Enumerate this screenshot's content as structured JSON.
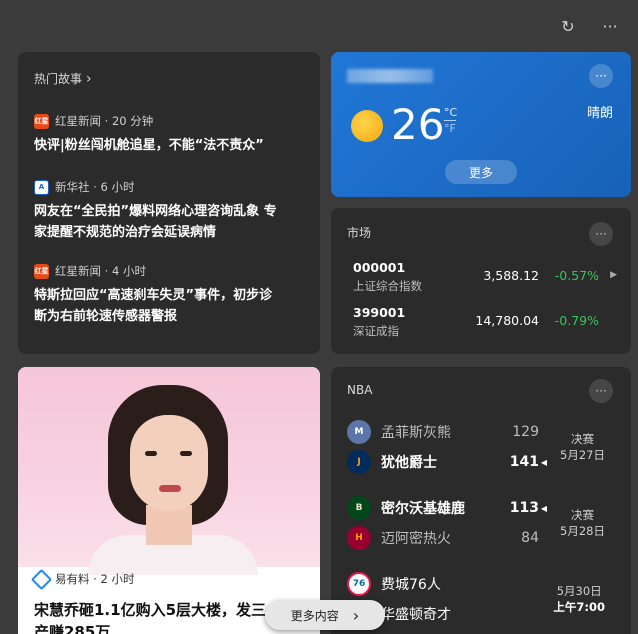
{
  "topbar": {
    "refresh_icon": "↻",
    "more_icon": "···"
  },
  "news": {
    "title": "热门故事",
    "chevron": "›",
    "items": [
      {
        "icon_label": "红星",
        "source": "红星新闻 · 20 分钟",
        "headline": "快评|粉丝闯机舱追星，不能“法不责众”"
      },
      {
        "icon_label": "A",
        "source": "新华社 · 6 小时",
        "headline_line1": "网友在“全民拍”爆料网络心理咨询乱象 专",
        "headline_line2": "家提醒不规范的治疗会延误病情"
      },
      {
        "icon_label": "红星",
        "source": "红星新闻 · 4 小时",
        "headline_line1": "特斯拉回应“高速刹车失灵”事件，初步诊",
        "headline_line2": "断为右前轮速传感器警报"
      }
    ]
  },
  "weather": {
    "more_icon": "···",
    "temperature": "26",
    "unit_c": "°C",
    "unit_f": "°F",
    "condition": "晴朗",
    "more_label": "更多",
    "accent": "#1f6fc9"
  },
  "market": {
    "title": "市场",
    "more_icon": "···",
    "rows": [
      {
        "code": "000001",
        "name": "上证综合指数",
        "price": "3,588.12",
        "change": "-0.57%",
        "arrow": "▶"
      },
      {
        "code": "399001",
        "name": "深证成指",
        "price": "14,780.04",
        "change": "-0.79%"
      }
    ],
    "change_color": "#39c45a"
  },
  "photo_news": {
    "source": "易有料 · 2 小时",
    "headline": "宋慧乔砸1.1亿购入5层大楼，发三",
    "headline_line2": "产赚285万"
  },
  "nba": {
    "title": "NBA",
    "more_icon": "···",
    "games": [
      {
        "team1": {
          "name": "孟菲斯灰熊",
          "score": "129"
        },
        "team2": {
          "name": "犹他爵士",
          "score": "141"
        },
        "status1": "决赛",
        "status2": "5月27日"
      },
      {
        "team1": {
          "name": "密尔沃基雄鹿",
          "score": "113"
        },
        "team2": {
          "name": "迈阿密热火",
          "score": "84"
        },
        "status1": "决赛",
        "status2": "5月28日"
      },
      {
        "team1": {
          "name": "费城76人",
          "score": ""
        },
        "team2": {
          "name": "华盛顿奇才",
          "score": ""
        },
        "status1": "5月30日",
        "status2": "上午7:00"
      }
    ],
    "win_marker": "◀"
  },
  "more_content": {
    "label": "更多内容",
    "chevron": "›"
  }
}
